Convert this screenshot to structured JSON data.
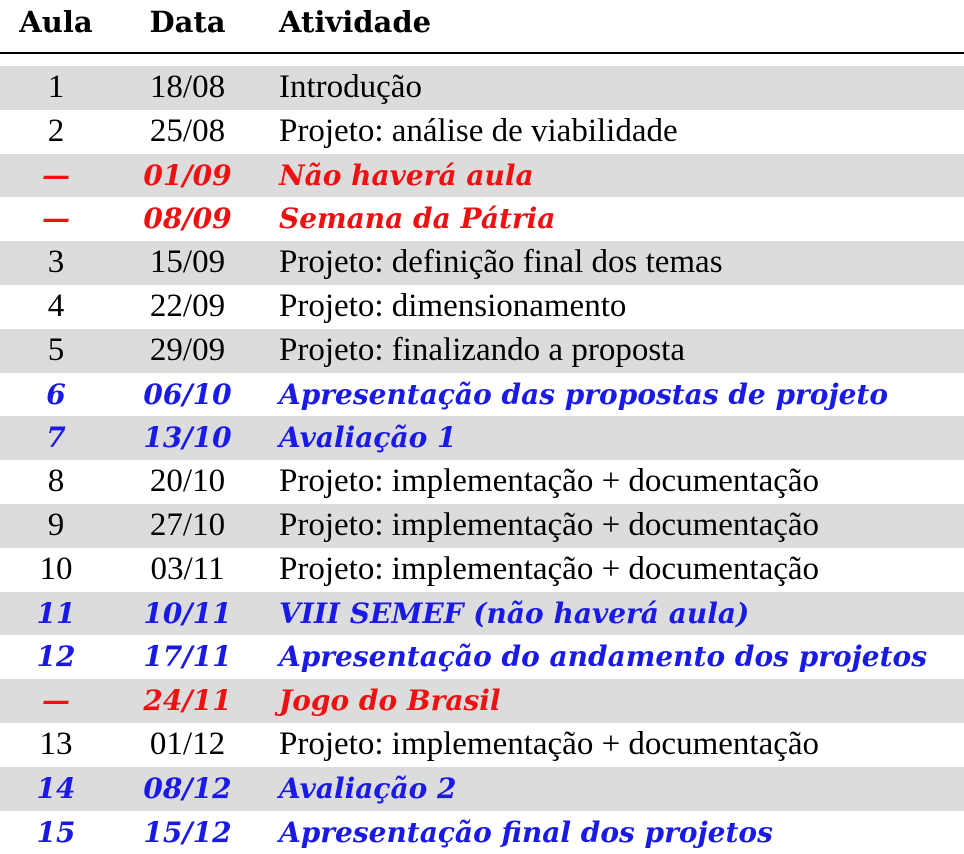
{
  "header": {
    "aula": "Aula",
    "data": "Data",
    "atividade": "Atividade"
  },
  "colors": {
    "red": "#ee1111",
    "blue": "#1a1ae6",
    "shade": "#dcdcdc"
  },
  "rows": [
    {
      "aula": "1",
      "data": "18/08",
      "atividade": "Introdução",
      "style": "normal"
    },
    {
      "aula": "2",
      "data": "25/08",
      "atividade": "Projeto: análise de viabilidade",
      "style": "normal"
    },
    {
      "aula": "—",
      "data": "01/09",
      "atividade": "Não haverá aula",
      "style": "red"
    },
    {
      "aula": "—",
      "data": "08/09",
      "atividade": "Semana da Pátria",
      "style": "red"
    },
    {
      "aula": "3",
      "data": "15/09",
      "atividade": "Projeto: definição final dos temas",
      "style": "normal"
    },
    {
      "aula": "4",
      "data": "22/09",
      "atividade": "Projeto: dimensionamento",
      "style": "normal"
    },
    {
      "aula": "5",
      "data": "29/09",
      "atividade": "Projeto: finalizando a proposta",
      "style": "normal"
    },
    {
      "aula": "6",
      "data": "06/10",
      "atividade": "Apresentação das propostas de projeto",
      "style": "blue"
    },
    {
      "aula": "7",
      "data": "13/10",
      "atividade": "Avaliação 1",
      "style": "blue"
    },
    {
      "aula": "8",
      "data": "20/10",
      "atividade": "Projeto: implementação + documentação",
      "style": "normal"
    },
    {
      "aula": "9",
      "data": "27/10",
      "atividade": "Projeto: implementação + documentação",
      "style": "normal"
    },
    {
      "aula": "10",
      "data": "03/11",
      "atividade": "Projeto: implementação + documentação",
      "style": "normal"
    },
    {
      "aula": "11",
      "data": "10/11",
      "atividade": "VIII SEMEF (não haverá aula)",
      "style": "blue"
    },
    {
      "aula": "12",
      "data": "17/11",
      "atividade": "Apresentação do andamento dos projetos",
      "style": "blue"
    },
    {
      "aula": "—",
      "data": "24/11",
      "atividade": "Jogo do Brasil",
      "style": "red"
    },
    {
      "aula": "13",
      "data": "01/12",
      "atividade": "Projeto: implementação + documentação",
      "style": "normal"
    },
    {
      "aula": "14",
      "data": "08/12",
      "atividade": "Avaliação 2",
      "style": "blue"
    },
    {
      "aula": "15",
      "data": "15/12",
      "atividade": "Apresentação final dos projetos",
      "style": "blue"
    }
  ]
}
